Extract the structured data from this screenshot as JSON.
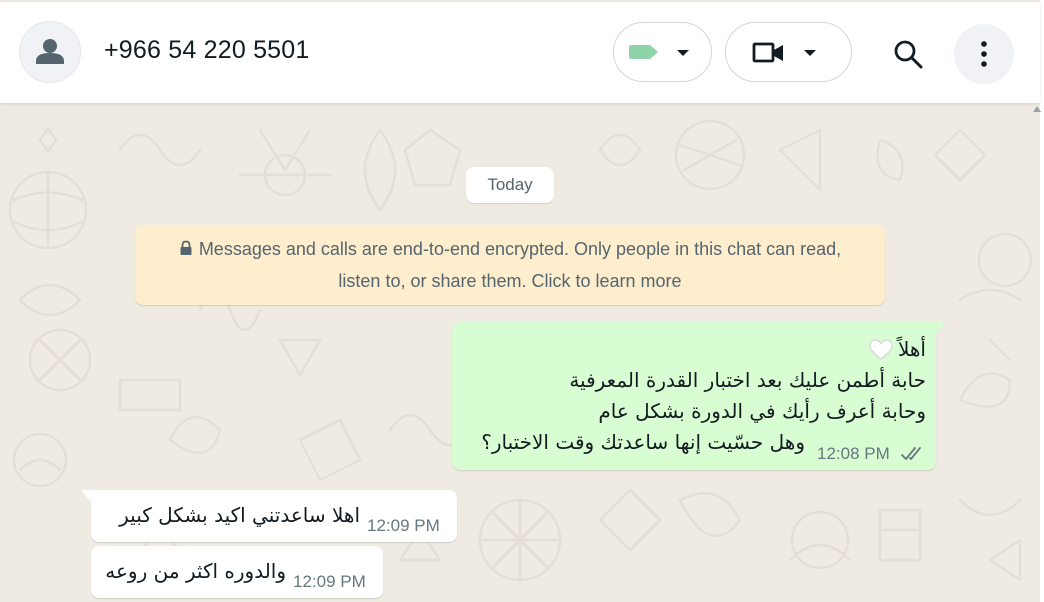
{
  "header": {
    "contact_name": "+966 54 220 5501",
    "avatar_icon": "default-user-icon",
    "label_icon": "label-tag-icon",
    "label_color": "#8fd4a8",
    "video_icon": "video-camera-icon",
    "search_icon": "search-icon",
    "menu_icon": "kebab-menu-icon"
  },
  "chat": {
    "date_chip": "Today",
    "encryption_notice": {
      "line1": "Messages and calls are end-to-end encrypted. Only people in this chat can read,",
      "line2": "listen to, or share them. Click to learn more"
    },
    "messages": [
      {
        "direction": "outgoing",
        "lines": [
          "أهلاً",
          "حابة أطمن عليك بعد اختبار القدرة المعرفية",
          "وحابة أعرف رأيك في الدورة بشكل عام",
          "وهل حسّيت إنها ساعدتك وقت الاختبار؟"
        ],
        "emoji": "white-heart-emoji",
        "time": "12:08 PM",
        "status": "read-double-tick"
      },
      {
        "direction": "incoming",
        "text": "اهلا ساعدتني اكيد بشكل كبير",
        "time": "12:09 PM"
      },
      {
        "direction": "incoming",
        "text": "والدوره اكثر من روعه",
        "time": "12:09 PM"
      }
    ]
  },
  "colors": {
    "chat_background": "#efeae2",
    "outgoing_bubble": "#d9fdd3",
    "incoming_bubble": "#ffffff",
    "encryption_notice_bg": "#ffeecd"
  }
}
